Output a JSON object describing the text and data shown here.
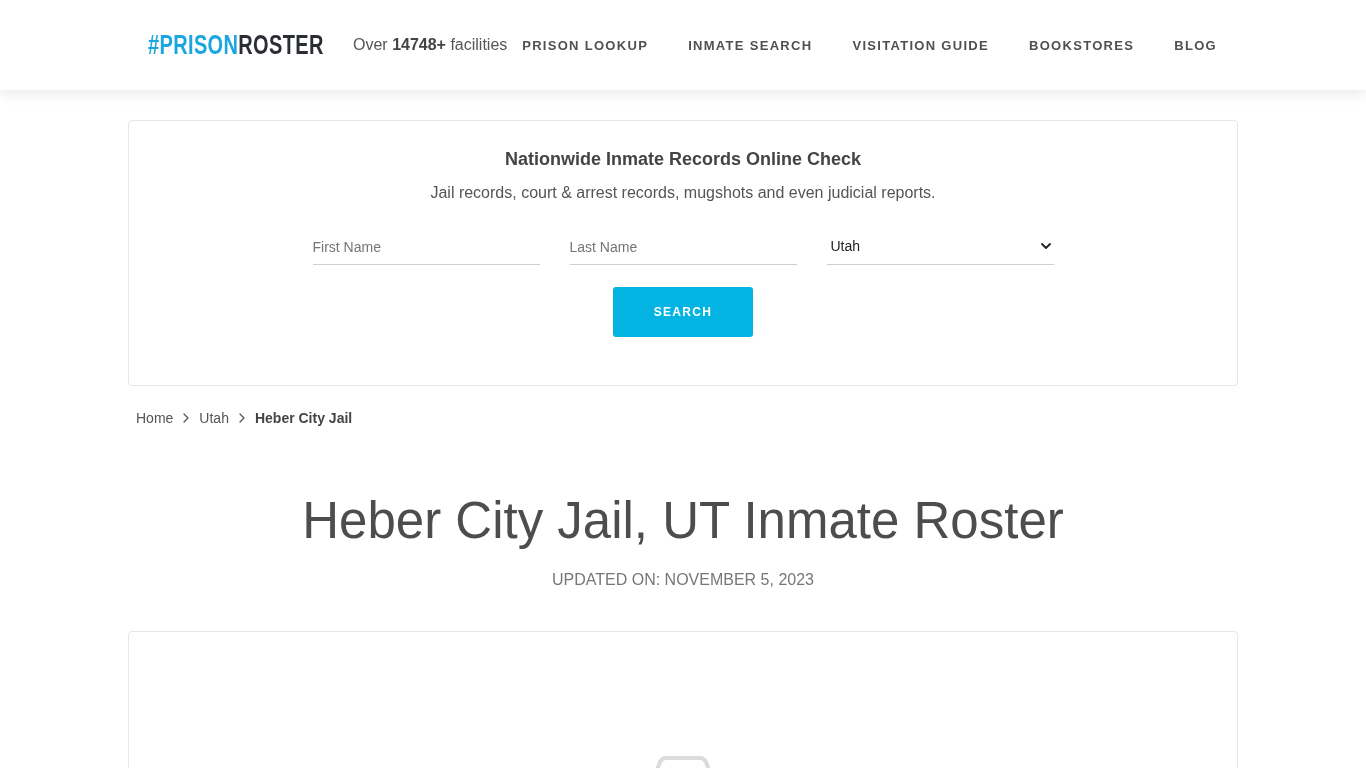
{
  "header": {
    "logo": {
      "accent": "#PRISON",
      "text": "ROSTER"
    },
    "tagline": "Over **14748+** facilities",
    "nav": [
      "PRISON LOOKUP",
      "INMATE SEARCH",
      "VISITATION GUIDE",
      "BOOKSTORES",
      "BLOG"
    ]
  },
  "search_card": {
    "title": "Nationwide Inmate Records Online Check",
    "subtitle": "Jail records, court & arrest records, mugshots and even judicial reports.",
    "fields": [
      {
        "kind": "text",
        "placeholder": "First Name"
      },
      {
        "kind": "text",
        "placeholder": "Last Name"
      },
      {
        "kind": "select",
        "value": "Utah"
      }
    ],
    "button": "SEARCH"
  },
  "breadcrumb": [
    {
      "label": "Home",
      "current": false
    },
    {
      "label": "Utah",
      "current": false
    },
    {
      "label": "Heber City Jail",
      "current": true
    }
  ],
  "page_title": "Heber City Jail, UT Inmate Roster",
  "updated": "UPDATED ON: NOVEMBER 5, 2023"
}
